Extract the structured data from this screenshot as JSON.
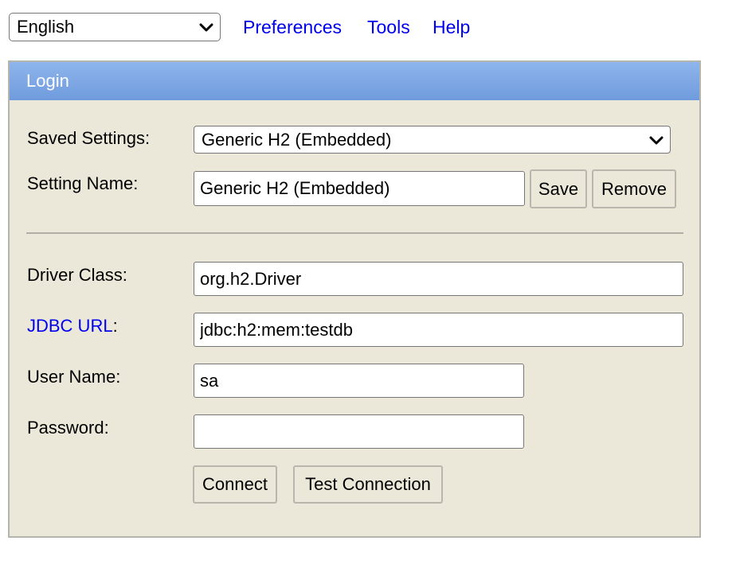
{
  "language_select": {
    "value": "English"
  },
  "top_nav": {
    "preferences": "Preferences",
    "tools": "Tools",
    "help": "Help"
  },
  "login": {
    "title": "Login",
    "saved_settings": {
      "label": "Saved Settings:",
      "value": "Generic H2 (Embedded)"
    },
    "setting_name": {
      "label": "Setting Name:",
      "value": "Generic H2 (Embedded)",
      "save_label": "Save",
      "remove_label": "Remove"
    },
    "driver_class": {
      "label": "Driver Class:",
      "value": "org.h2.Driver"
    },
    "jdbc_url": {
      "label_link": "JDBC URL",
      "label_suffix": ":",
      "value": "jdbc:h2:mem:testdb"
    },
    "user_name": {
      "label": "User Name:",
      "value": "sa"
    },
    "password": {
      "label": "Password:",
      "value": ""
    },
    "connect_label": "Connect",
    "test_connection_label": "Test Connection"
  },
  "icons": {
    "dropdown": "chevron-down-icon"
  },
  "colors": {
    "header_gradient_top": "#8eb5ec",
    "header_gradient_bottom": "#6f9bdd",
    "panel_background": "#ebe8d9",
    "link": "#0000ee"
  }
}
